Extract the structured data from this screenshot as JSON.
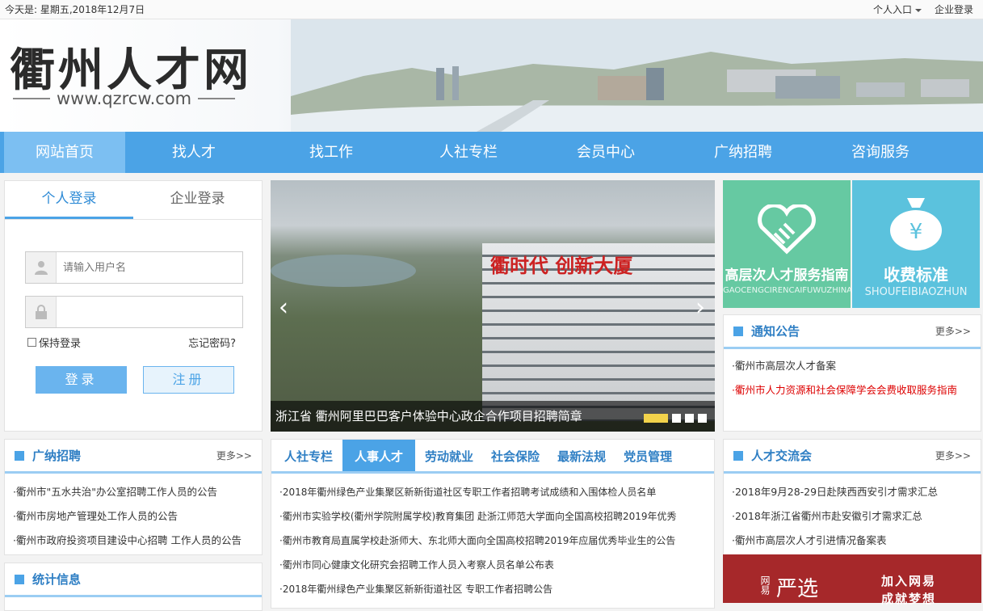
{
  "topbar": {
    "date": "今天是: 星期五,2018年12月7日",
    "personal": "个人入口",
    "company": "企业登录"
  },
  "banner": {
    "logo": "衢州人才网",
    "url": "www.qzrcw.com"
  },
  "nav": [
    "网站首页",
    "找人才",
    "找工作",
    "人社专栏",
    "会员中心",
    "广纳招聘",
    "咨询服务"
  ],
  "login": {
    "tab_personal": "个人登录",
    "tab_company": "企业登录",
    "username_placeholder": "请输入用户名",
    "remember": "保持登录",
    "forgot": "忘记密码?",
    "login_btn": "登录",
    "register_btn": "注册"
  },
  "slider": {
    "sign": "衢时代 创新大厦",
    "caption": "浙江省 衢州阿里巴巴客户体验中心政企合作项目招聘简章",
    "prev": "‹",
    "next": "›"
  },
  "tiles": [
    {
      "title": "高层次人才服务指南",
      "sub": "GAOCENGCIRENCAIFUWUZHINAN"
    },
    {
      "title": "收费标准",
      "sub": "SHOUFEIBIAOZHUN"
    }
  ],
  "notice": {
    "title": "通知公告",
    "more": "更多>>",
    "items": [
      "·衢州市高层次人才备案",
      "·衢州市人力资源和社会保障学会会费收取服务指南"
    ]
  },
  "recruit": {
    "title": "广纳招聘",
    "more": "更多>>",
    "items": [
      "·衢州市\"五水共治\"办公室招聘工作人员的公告",
      "·衢州市房地产管理处工作人员的公告",
      "·衢州市政府投资项目建设中心招聘 工作人员的公告"
    ]
  },
  "stats": {
    "title": "统计信息"
  },
  "midtabs": [
    "人社专栏",
    "人事人才",
    "劳动就业",
    "社会保险",
    "最新法规",
    "党员管理"
  ],
  "midlist": [
    "·2018年衢州绿色产业集聚区新新街道社区专职工作者招聘考试成绩和入围体检人员名单",
    "·衢州市实验学校(衢州学院附属学校)教育集团 赴浙江师范大学面向全国高校招聘2019年优秀",
    "·衢州市教育局直属学校赴浙师大、东北师大面向全国高校招聘2019年应届优秀毕业生的公告",
    "·衢州市同心健康文化研究会招聘工作人员入考察人员名单公布表",
    "·2018年衢州绿色产业集聚区新新街道社区 专职工作者招聘公告"
  ],
  "exchange": {
    "title": "人才交流会",
    "more": "更多>>",
    "items": [
      "·2018年9月28-29日赴陕西西安引才需求汇总",
      "·2018年浙江省衢州市赴安徽引才需求汇总",
      "·衢州市高层次人才引进情况备案表"
    ]
  },
  "ad": {
    "a": "网易",
    "b": "严选",
    "c": "加入网易",
    "d": "成就梦想"
  }
}
